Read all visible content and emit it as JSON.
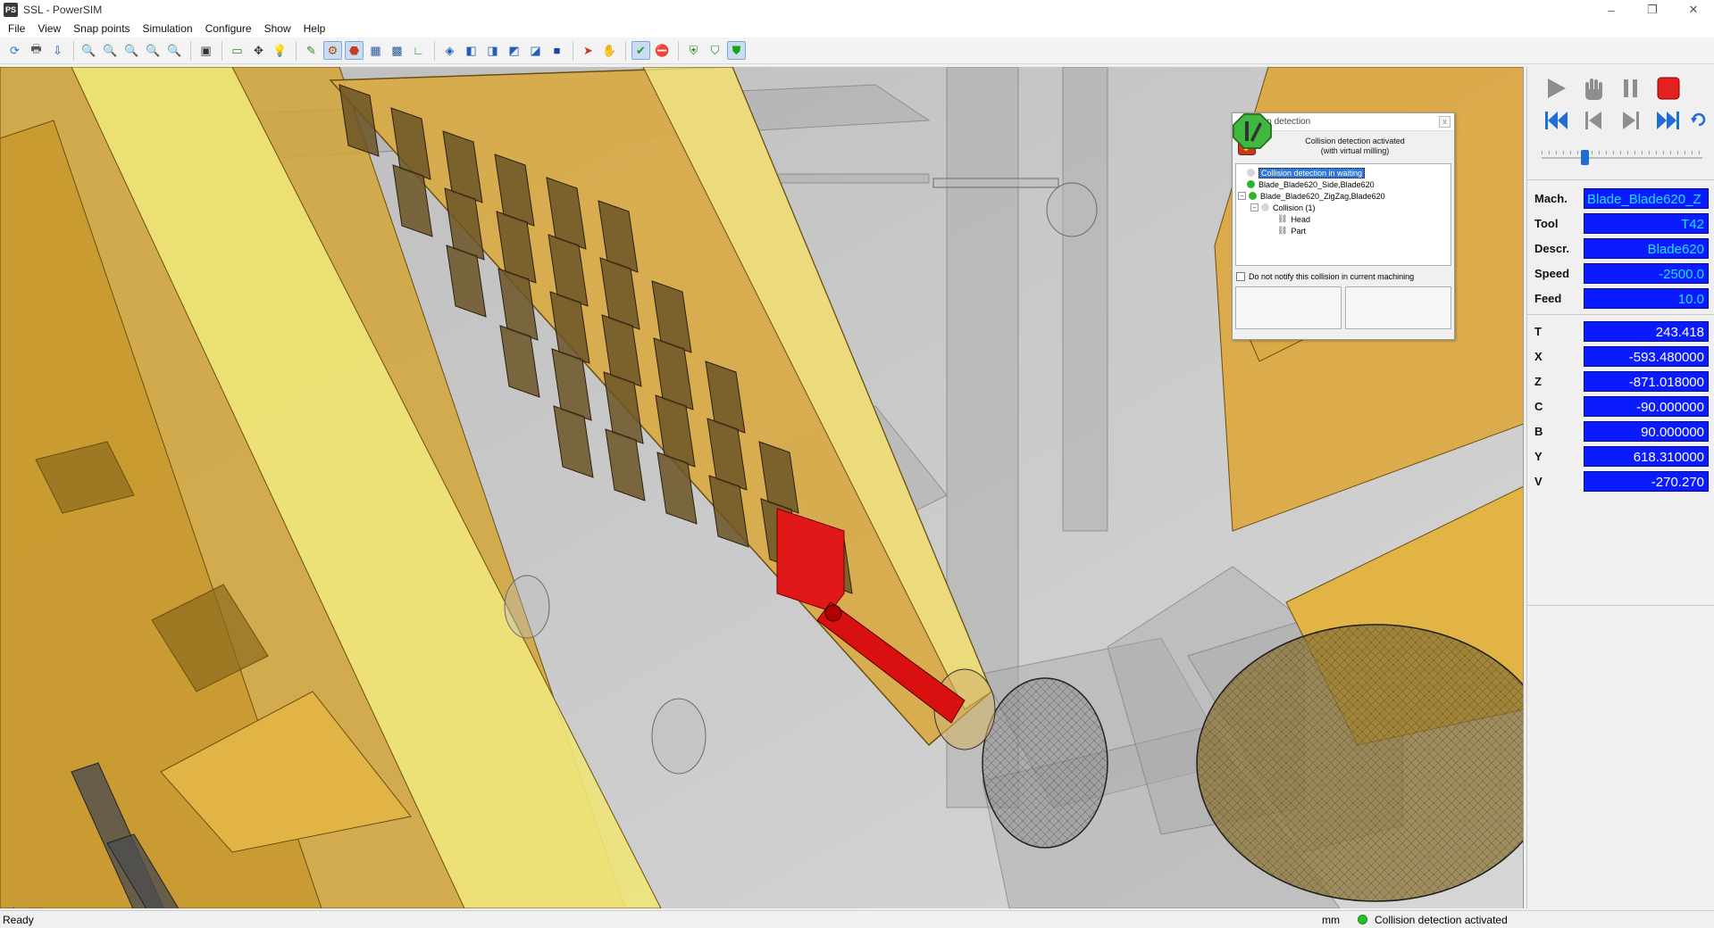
{
  "window": {
    "app_icon": "PS",
    "title": "SSL - PowerSIM",
    "minimize": "–",
    "maximize": "❐",
    "close": "✕"
  },
  "menu": [
    "File",
    "View",
    "Snap points",
    "Simulation",
    "Configure",
    "Show",
    "Help"
  ],
  "toolbar": {
    "groups": [
      [
        "open-icon",
        "print-icon",
        "import-icon"
      ],
      [
        "zoom-in-icon",
        "zoom-window-icon",
        "zoom-out-icon",
        "zoom-prev-icon",
        "zoom-all-icon"
      ],
      [
        "frame-icon"
      ],
      [
        "display-icon",
        "select-icon",
        "light-icon"
      ],
      [
        "pencil-icon",
        "machine-icon",
        "collision-icon",
        "table-icon",
        "grid-icon",
        "axes-icon"
      ],
      [
        "view-iso-icon",
        "view-front-icon",
        "view-left-icon",
        "view-right-icon",
        "view-back-icon",
        "view-top-icon"
      ],
      [
        "arrow-icon",
        "hand-icon"
      ],
      [
        "check-icon",
        "stop-icon"
      ],
      [
        "shield-icon",
        "shield-outline-icon",
        "shield-green-icon"
      ]
    ],
    "active": [
      "machine-icon",
      "collision-icon",
      "check-icon",
      "shield-green-icon"
    ],
    "glyphs": {
      "open-icon": "⟳",
      "print-icon": "🖶",
      "import-icon": "⇩",
      "zoom-in-icon": "🔍",
      "zoom-window-icon": "🔍",
      "zoom-out-icon": "🔍",
      "zoom-prev-icon": "🔍",
      "zoom-all-icon": "🔍",
      "frame-icon": "▣",
      "display-icon": "▭",
      "select-icon": "✥",
      "light-icon": "💡",
      "pencil-icon": "✎",
      "machine-icon": "⚙",
      "collision-icon": "⬣",
      "table-icon": "▦",
      "grid-icon": "▩",
      "axes-icon": "∟",
      "view-iso-icon": "◈",
      "view-front-icon": "◧",
      "view-left-icon": "◨",
      "view-right-icon": "◩",
      "view-back-icon": "◪",
      "view-top-icon": "■",
      "arrow-icon": "➤",
      "hand-icon": "✋",
      "check-icon": "✔",
      "stop-icon": "⛔",
      "shield-icon": "⛨",
      "shield-outline-icon": "⛉",
      "shield-green-icon": "⛊"
    },
    "colors": {
      "open-icon": "#2a7ad6",
      "print-icon": "#555",
      "import-icon": "#1f5fb5",
      "zoom-in-icon": "#b22",
      "zoom-window-icon": "#b22",
      "zoom-out-icon": "#b22",
      "zoom-prev-icon": "#b22",
      "zoom-all-icon": "#b22",
      "frame-icon": "#333",
      "display-icon": "#2a8a2a",
      "select-icon": "#333",
      "light-icon": "#e0b000",
      "pencil-icon": "#2a8a2a",
      "machine-icon": "#b04a00",
      "collision-icon": "#c23b22",
      "table-icon": "#2a5aa0",
      "grid-icon": "#2a5aa0",
      "axes-icon": "#2a8a2a",
      "view-iso-icon": "#1f5fb5",
      "view-front-icon": "#1f5fb5",
      "view-left-icon": "#1f5fb5",
      "view-right-icon": "#1f5fb5",
      "view-back-icon": "#1f5fb5",
      "view-top-icon": "#1f3fa5",
      "arrow-icon": "#c23b22",
      "hand-icon": "#c23b22",
      "check-icon": "#2a9a2a",
      "stop-icon": "#c23b22",
      "shield-icon": "#2a8a2a",
      "shield-outline-icon": "#2a8a2a",
      "shield-green-icon": "#1aa31a"
    }
  },
  "collision_dialog": {
    "title": "Collision detection",
    "close": "x",
    "status_line1": "Collision detection activated",
    "status_line2": "(with virtual milling)",
    "tree": {
      "root": "Collision detection in waiting",
      "item1": "Blade_Blade620_Side,Blade620",
      "item2": "Blade_Blade620_ZigZag,Blade620",
      "collision": "Collision (1)",
      "head": "Head",
      "part": "Part"
    },
    "notify_label": "Do not notify this collision in current machining",
    "stop_button_color": "#d7352a",
    "continue_button_color": "#3fb83f"
  },
  "controls": {
    "play": "play-icon",
    "hand": "hand-icon",
    "pause": "pause-icon",
    "stop": "stop-icon",
    "first": "first-icon",
    "prev": "prev-icon",
    "next": "next-icon",
    "last": "last-icon",
    "loop": "loop-icon",
    "speed_slider": 0.26
  },
  "fields": {
    "mach": {
      "label": "Mach.",
      "value": "Blade_Blade620_Z"
    },
    "tool": {
      "label": "Tool",
      "value": "T42"
    },
    "descr": {
      "label": "Descr.",
      "value": "Blade620"
    },
    "speed": {
      "label": "Speed",
      "value": "-2500.0"
    },
    "feed": {
      "label": "Feed",
      "value": "10.0"
    },
    "t": {
      "label": "T",
      "value": "243.418"
    },
    "x": {
      "label": "X",
      "value": "-593.480000"
    },
    "z": {
      "label": "Z",
      "value": "-871.018000"
    },
    "c": {
      "label": "C",
      "value": "-90.000000"
    },
    "b": {
      "label": "B",
      "value": "90.000000"
    },
    "y": {
      "label": "Y",
      "value": "618.310000"
    },
    "v": {
      "label": "V",
      "value": "-270.270"
    }
  },
  "statusbar": {
    "ready": "Ready",
    "unit": "mm",
    "status": "Collision detection activated"
  },
  "scene": {
    "background": "#c9c9c9",
    "wood_color": "#d4a63a",
    "panel_yellow": "#eee67a",
    "collision_red": "#e01818"
  }
}
